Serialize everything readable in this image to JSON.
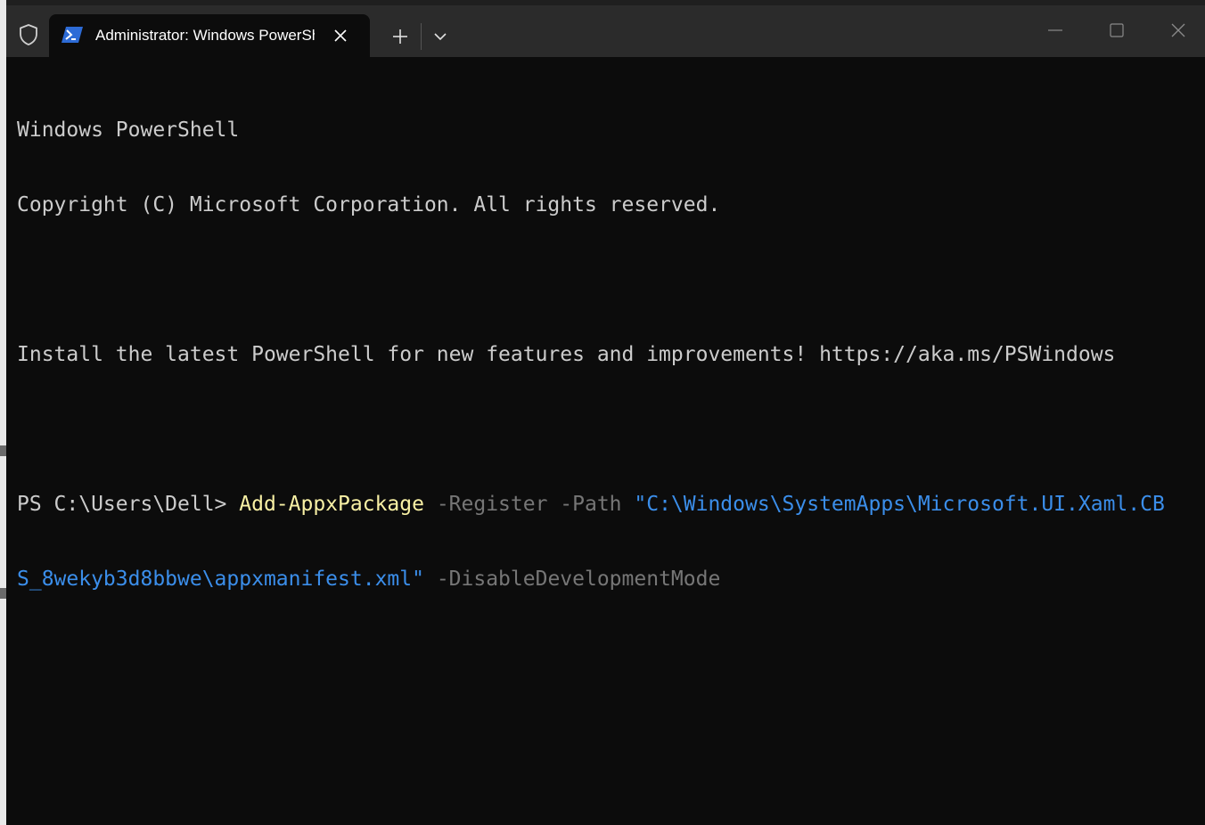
{
  "tab": {
    "title": "Administrator: Windows PowerShell",
    "icon": "powershell-icon",
    "close_icon": "close-icon"
  },
  "toolbar": {
    "new_tab_icon": "plus-icon",
    "dropdown_icon": "chevron-down-icon"
  },
  "window_controls": {
    "minimize_icon": "minimize-icon",
    "maximize_icon": "maximize-icon",
    "close_icon": "close-icon"
  },
  "terminal": {
    "line1": "Windows PowerShell",
    "line2": "Copyright (C) Microsoft Corporation. All rights reserved.",
    "line3": "",
    "line4": "Install the latest PowerShell for new features and improvements! https://aka.ms/PSWindows",
    "line5": "",
    "prompt": "PS C:\\Users\\Dell> ",
    "command": "Add-AppxPackage",
    "params1": " -Register -Path ",
    "path_part1": "\"C:\\Windows\\SystemApps\\Microsoft.UI.Xaml.CB",
    "path_part2": "S_8wekyb3d8bbwe\\appxmanifest.xml\"",
    "params2": " -DisableDevelopmentMode"
  },
  "colors": {
    "background": "#0c0c0c",
    "titlebar": "#2b2b2b",
    "text": "#cccccc",
    "command": "#f9f1a5",
    "parameter": "#767676",
    "string": "#3b8eea"
  }
}
